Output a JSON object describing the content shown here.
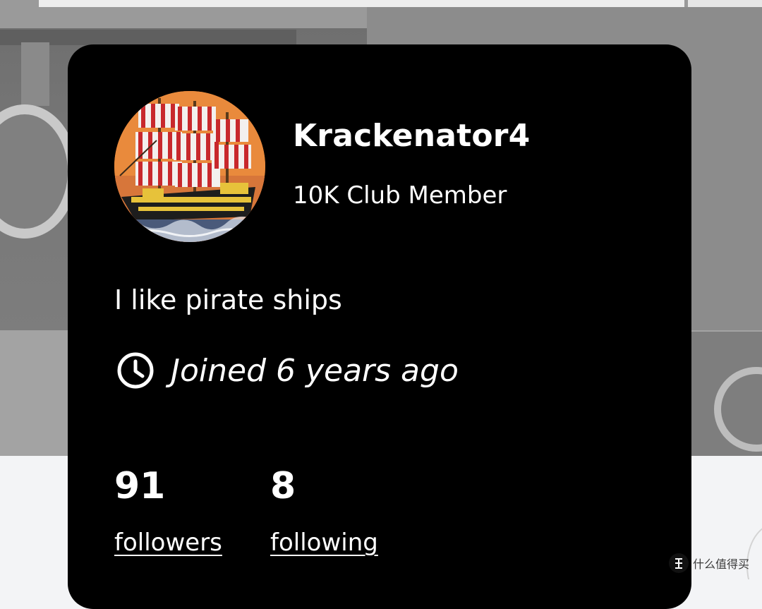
{
  "profile": {
    "username": "Krackenator4",
    "rank": "10K Club Member",
    "bio": "I like pirate ships",
    "joined": "Joined 6 years ago",
    "avatar_icon": "pirate-ship-avatar"
  },
  "stats": {
    "followers": {
      "value": "91",
      "label": "followers"
    },
    "following": {
      "value": "8",
      "label": "following"
    }
  },
  "icons": {
    "joined": "clock-icon"
  },
  "colors": {
    "card_background": "#000000",
    "text": "#ffffff",
    "avatar_background": "#e8843a"
  },
  "watermark": {
    "text": "什么值得买",
    "badge": "值"
  }
}
